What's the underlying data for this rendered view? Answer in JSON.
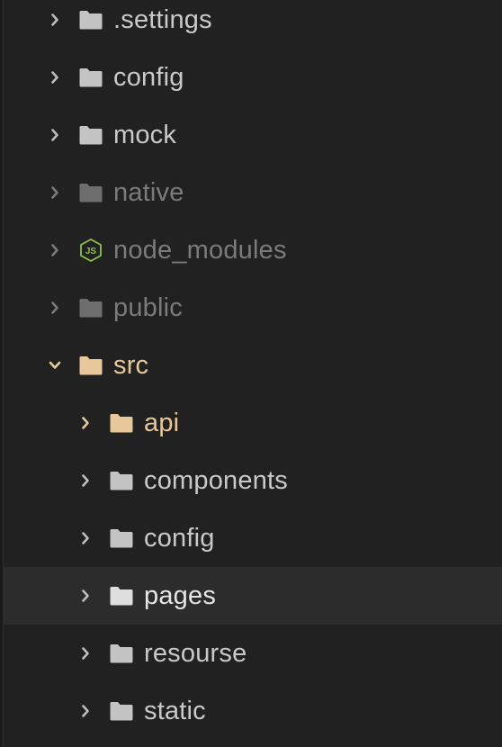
{
  "colors": {
    "background": "#212121",
    "selected_row": "#2c2c2c",
    "text_normal": "#c9c9c9",
    "text_dim": "#7b7b7b",
    "text_active": "#e8c89a",
    "text_selected": "#e6e6e6",
    "folder_normal": "#c4c4c4",
    "folder_dim": "#6e6e6e",
    "folder_active": "#e8c89a",
    "folder_selected": "#dedede",
    "chevron_normal": "#bdbdbd",
    "chevron_dim": "#7b7b7b",
    "chevron_active": "#e8c89a",
    "node_icon": "#8cc44a"
  },
  "tree": {
    "items": [
      {
        "label": ".settings",
        "icon": "folder-icon",
        "expanded": false,
        "depth": 0,
        "state": "normal"
      },
      {
        "label": "config",
        "icon": "folder-icon",
        "expanded": false,
        "depth": 0,
        "state": "normal"
      },
      {
        "label": "mock",
        "icon": "folder-icon",
        "expanded": false,
        "depth": 0,
        "state": "normal"
      },
      {
        "label": "native",
        "icon": "folder-icon",
        "expanded": false,
        "depth": 0,
        "state": "dim"
      },
      {
        "label": "node_modules",
        "icon": "nodejs-icon",
        "expanded": false,
        "depth": 0,
        "state": "dim"
      },
      {
        "label": "public",
        "icon": "folder-icon",
        "expanded": false,
        "depth": 0,
        "state": "dim"
      },
      {
        "label": "src",
        "icon": "folder-open-icon",
        "expanded": true,
        "depth": 0,
        "state": "active"
      },
      {
        "label": "api",
        "icon": "folder-icon",
        "expanded": false,
        "depth": 1,
        "state": "active"
      },
      {
        "label": "components",
        "icon": "folder-icon",
        "expanded": false,
        "depth": 1,
        "state": "normal"
      },
      {
        "label": "config",
        "icon": "folder-icon",
        "expanded": false,
        "depth": 1,
        "state": "normal"
      },
      {
        "label": "pages",
        "icon": "folder-icon",
        "expanded": false,
        "depth": 1,
        "state": "selected"
      },
      {
        "label": "resourse",
        "icon": "folder-icon",
        "expanded": false,
        "depth": 1,
        "state": "normal"
      },
      {
        "label": "static",
        "icon": "folder-icon",
        "expanded": false,
        "depth": 1,
        "state": "normal"
      }
    ]
  }
}
